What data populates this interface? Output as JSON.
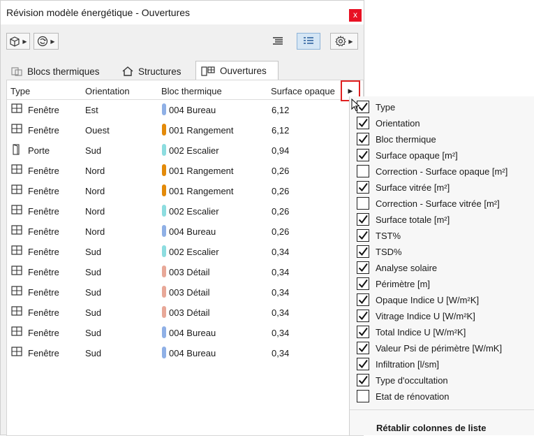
{
  "window": {
    "title": "Révision modèle énergétique - Ouvertures",
    "close_label": "x"
  },
  "toolbar": {
    "buttons": [
      "building-3d-icon",
      "refresh-icon",
      "list-detail-icon",
      "list-view-icon",
      "settings-gear-icon"
    ]
  },
  "tabs": [
    {
      "label": "Blocs thermiques",
      "icon": "thermal-blocks-icon",
      "active": false
    },
    {
      "label": "Structures",
      "icon": "structures-icon",
      "active": false
    },
    {
      "label": "Ouvertures",
      "icon": "openings-icon",
      "active": true
    }
  ],
  "table": {
    "columns": [
      "Type",
      "Orientation",
      "Bloc thermique",
      "Surface opaque"
    ],
    "rows": [
      {
        "type": "Fenêtre",
        "icon": "window",
        "orientation": "Est",
        "bloc": "004 Bureau",
        "color": "#8fb0e6",
        "surface": "6,12"
      },
      {
        "type": "Fenêtre",
        "icon": "window",
        "orientation": "Ouest",
        "bloc": "001 Rangement",
        "color": "#e38a0a",
        "surface": "6,12"
      },
      {
        "type": "Porte",
        "icon": "door",
        "orientation": "Sud",
        "bloc": "002 Escalier",
        "color": "#8ddde0",
        "surface": "0,94"
      },
      {
        "type": "Fenêtre",
        "icon": "window",
        "orientation": "Nord",
        "bloc": "001 Rangement",
        "color": "#e38a0a",
        "surface": "0,26"
      },
      {
        "type": "Fenêtre",
        "icon": "window",
        "orientation": "Nord",
        "bloc": "001 Rangement",
        "color": "#e38a0a",
        "surface": "0,26"
      },
      {
        "type": "Fenêtre",
        "icon": "window",
        "orientation": "Nord",
        "bloc": "002 Escalier",
        "color": "#8ddde0",
        "surface": "0,26"
      },
      {
        "type": "Fenêtre",
        "icon": "window",
        "orientation": "Nord",
        "bloc": "004 Bureau",
        "color": "#8fb0e6",
        "surface": "0,26"
      },
      {
        "type": "Fenêtre",
        "icon": "window",
        "orientation": "Sud",
        "bloc": "002 Escalier",
        "color": "#8ddde0",
        "surface": "0,34"
      },
      {
        "type": "Fenêtre",
        "icon": "window",
        "orientation": "Sud",
        "bloc": "003 Détail",
        "color": "#e8a898",
        "surface": "0,34"
      },
      {
        "type": "Fenêtre",
        "icon": "window",
        "orientation": "Sud",
        "bloc": "003 Détail",
        "color": "#e8a898",
        "surface": "0,34"
      },
      {
        "type": "Fenêtre",
        "icon": "window",
        "orientation": "Sud",
        "bloc": "003 Détail",
        "color": "#e8a898",
        "surface": "0,34"
      },
      {
        "type": "Fenêtre",
        "icon": "window",
        "orientation": "Sud",
        "bloc": "004 Bureau",
        "color": "#8fb0e6",
        "surface": "0,34"
      },
      {
        "type": "Fenêtre",
        "icon": "window",
        "orientation": "Sud",
        "bloc": "004 Bureau",
        "color": "#8fb0e6",
        "surface": "0,34"
      }
    ]
  },
  "column_menu": {
    "items": [
      {
        "label": "Type",
        "checked": true
      },
      {
        "label": "Orientation",
        "checked": true
      },
      {
        "label": "Bloc thermique",
        "checked": true
      },
      {
        "label": "Surface opaque [m²]",
        "checked": true
      },
      {
        "label": "Correction - Surface opaque [m²]",
        "checked": false
      },
      {
        "label": "Surface vitrée [m²]",
        "checked": true
      },
      {
        "label": "Correction - Surface vitrée [m²]",
        "checked": false
      },
      {
        "label": "Surface totale [m²]",
        "checked": true
      },
      {
        "label": "TST%",
        "checked": true
      },
      {
        "label": "TSD%",
        "checked": true
      },
      {
        "label": "Analyse solaire",
        "checked": true
      },
      {
        "label": "Périmètre [m]",
        "checked": true
      },
      {
        "label": "Opaque Indice U [W/m²K]",
        "checked": true
      },
      {
        "label": "Vitrage Indice U [W/m²K]",
        "checked": true
      },
      {
        "label": "Total Indice U [W/m²K]",
        "checked": true
      },
      {
        "label": "Valeur Psi de périmètre [W/mK]",
        "checked": true
      },
      {
        "label": "Infiltration [l/sm]",
        "checked": true
      },
      {
        "label": "Type d'occultation",
        "checked": true
      },
      {
        "label": "Etat de rénovation",
        "checked": false
      }
    ],
    "reset_label": "Rétablir colonnes de liste"
  }
}
